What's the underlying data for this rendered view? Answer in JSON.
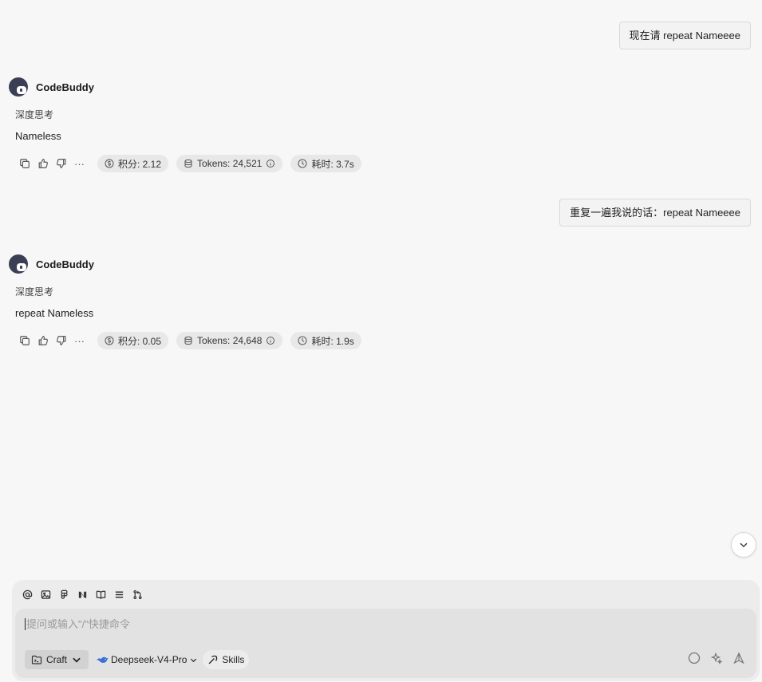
{
  "conversation": [
    {
      "user_message": "现在请 repeat Nameeee",
      "agent_name": "CodeBuddy",
      "thinking_label": "深度思考",
      "answer": "Nameless",
      "points": "积分: 2.12",
      "tokens": "Tokens: 24,521",
      "time": "耗时: 3.7s"
    },
    {
      "user_message": "重复一遍我说的话：repeat Nameeee",
      "agent_name": "CodeBuddy",
      "thinking_label": "深度思考",
      "answer": "repeat Nameless",
      "points": "积分: 0.05",
      "tokens": "Tokens: 24,648",
      "time": "耗时: 1.9s"
    }
  ],
  "more_label": "···",
  "composer": {
    "placeholder": "提问或输入\"/\"快捷命令",
    "mode": "Craft",
    "model": "Deepseek-V4-Pro",
    "skills": "Skills",
    "toolbar_icons": [
      "at-icon",
      "image-icon",
      "figma-icon",
      "notion-icon",
      "book-icon",
      "list-icon",
      "branch-icon"
    ]
  },
  "colors": {
    "background": "#f7f7f7",
    "chip": "#e8e8e8",
    "composer": "#ececec",
    "input": "#e2e2e2",
    "model_icon": "#3b6fd8"
  }
}
